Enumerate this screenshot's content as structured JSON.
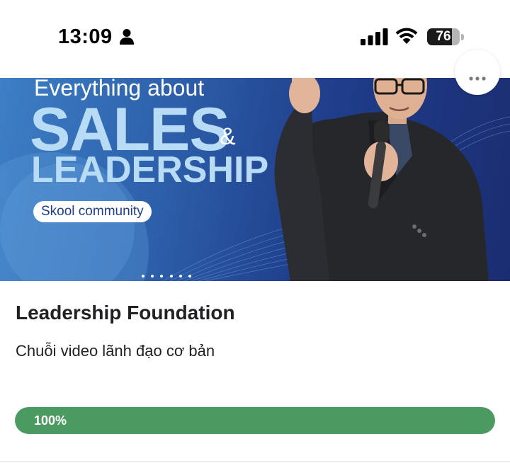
{
  "status_bar": {
    "time": "13:09",
    "battery_level": "76",
    "battery_fraction": 0.76,
    "icons": [
      "person-icon",
      "cellular-signal-icon",
      "wifi-icon",
      "battery-icon"
    ]
  },
  "banner": {
    "line1": "Everything about",
    "line2": "SALES",
    "ampersand": "&",
    "line3": "LEADERSHIP",
    "pill": "Skool community",
    "carousel_dot_count": 6,
    "colors": {
      "background_start": "#3d7fc6",
      "background_end": "#1b2d72",
      "headline": "#b9dcf6"
    }
  },
  "more_button": {
    "icon": "more-horizontal-icon"
  },
  "course": {
    "title": "Leadership Foundation",
    "description": "Chuỗi video lãnh đạo cơ bản",
    "progress_label": "100%",
    "progress_fraction": 1.0,
    "progress_color": "#4a9a62"
  }
}
